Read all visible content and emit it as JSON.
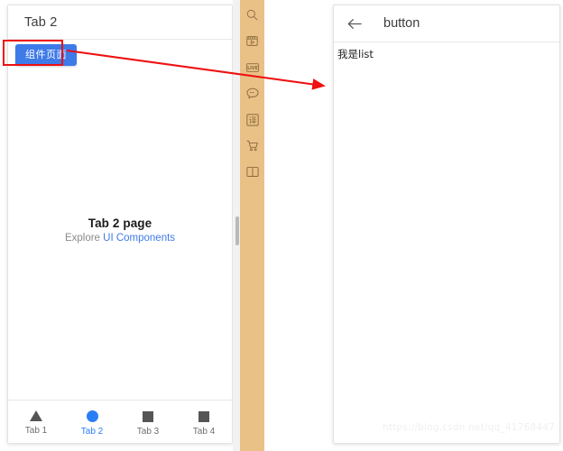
{
  "left_panel": {
    "header_title": "Tab 2",
    "component_button_label": "组件页面",
    "center": {
      "title": "Tab 2 page",
      "subtitle_prefix": "Explore ",
      "subtitle_link": "UI Components"
    },
    "tabbar": [
      {
        "label": "Tab 1",
        "icon": "triangle-icon",
        "active": false
      },
      {
        "label": "Tab 2",
        "icon": "circle-icon",
        "active": true
      },
      {
        "label": "Tab 3",
        "icon": "square-icon",
        "active": false
      },
      {
        "label": "Tab 4",
        "icon": "square-icon",
        "active": false
      }
    ]
  },
  "sidebar": {
    "background_color": "#e9c187",
    "items": [
      {
        "name": "search-icon",
        "title": "搜索"
      },
      {
        "name": "video-icon",
        "title": "视频"
      },
      {
        "name": "live-icon",
        "title": "LIVE"
      },
      {
        "name": "chat-bubble-icon",
        "title": "消息"
      },
      {
        "name": "translate-icon",
        "title": "译"
      },
      {
        "name": "shopping-cart-icon",
        "title": "购物车"
      },
      {
        "name": "book-icon",
        "title": "书籍"
      }
    ]
  },
  "right_panel": {
    "back_icon": "back-arrow-icon",
    "header_title": "button",
    "list_text": "我是list"
  },
  "annotation": {
    "highlight_color": "#ee1111",
    "arrow_color": "#ee1111",
    "arrow_from": "组件页面",
    "arrow_to": "button page"
  },
  "watermark": {
    "text": "https://blog.csdn.net/qq_41768447"
  },
  "colors": {
    "accent_blue": "#3e7ae8",
    "tab_active_blue": "#2a7ef5",
    "sidebar_orange": "#e9c187",
    "annotation_red": "#ee1111"
  }
}
